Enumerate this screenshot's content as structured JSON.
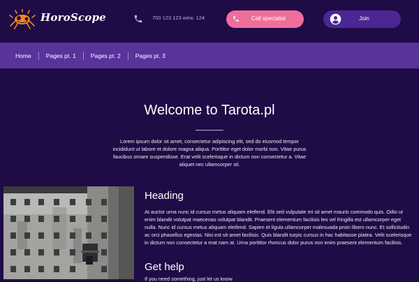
{
  "header": {
    "brand": "HoroScope",
    "phone": "700 123 123 wew. 124",
    "call_label": "Call specialist",
    "join_label": "Join"
  },
  "nav": {
    "items": [
      "Home",
      "Pages pt. 1",
      "Pages pt. 2",
      "Pages pt. 3"
    ]
  },
  "hero": {
    "title": "Welcome to Tarota.pl",
    "text": "Lorem ipsum dolor sit amet, consectetur adipiscing elit, sed do eiusmod tempor incididunt ut labore et dolore magna aliqua. Porttitor eget dolor morbi non. Vitae purus faucibus ornare suspendisse. Erat velit scelerisque in dictum non consectetur a. Vitae aliquet nec ullamcorper sit."
  },
  "section": {
    "heading": "Heading",
    "text": "At auctor urna nunc id cursus metus aliquam eleifend. Elit sed vulputate mi sit amet mauris commodo quis. Odio ut enim blandit volutpat maecenas volutpat blandit. Praesent elementum facilisis leo vel fringilla est ullamcorper eget nulla. Nunc id cursus metus aliquam eleifend. Sapien et ligula ullamcorper malesuada proin libero nunc. Et sollicitudin ac orci phasellus egestas. Nisi est sit amet facilisis. Quis blandit turpis cursus in hac habitasse platea. Velit scelerisque in dictum non consectetur a erat nam at. Urna porttitor rhoncus dolor purus non enim praesent elementum facilisis.",
    "help_heading": "Get help",
    "help_text": "If you need something, just let us know"
  },
  "colors": {
    "background": "#1f0b45",
    "nav": "#57339a",
    "call_button": "#ee6f9c",
    "join_button": "#4a2794",
    "logo": "#f0891c"
  },
  "icons": {
    "logo": "crab-logo-icon",
    "phone": "phone-icon",
    "user": "user-circle-icon"
  }
}
